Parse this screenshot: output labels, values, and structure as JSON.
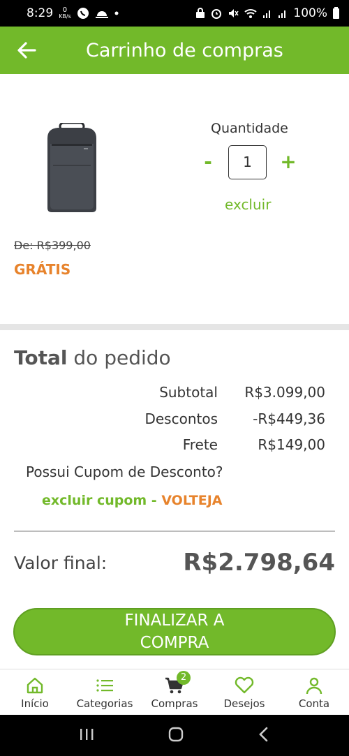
{
  "status_bar": {
    "time": "8:29",
    "net_speed_value": "0",
    "net_speed_unit": "KB/s",
    "battery": "100%"
  },
  "app_bar": {
    "title": "Carrinho de compras"
  },
  "product": {
    "quantity_label": "Quantidade",
    "quantity": "1",
    "minus": "-",
    "plus": "+",
    "remove_label": "excluir",
    "old_price": "De: R$399,00",
    "price": "GRÁTIS"
  },
  "summary": {
    "title_bold": "Total",
    "title_rest": " do pedido",
    "rows": [
      {
        "label": "Subtotal",
        "value": "R$3.099,00"
      },
      {
        "label": "Descontos",
        "value": "-R$449,36"
      },
      {
        "label": "Frete",
        "value": "R$149,00"
      }
    ],
    "coupon_question": "Possui Cupom de Desconto?",
    "coupon_remove": "excluir cupom -",
    "coupon_code": "VOLTEJA",
    "final_label": "Valor final:",
    "final_value": "R$2.798,64"
  },
  "checkout": {
    "label": "FINALIZAR A COMPRA"
  },
  "bottom_nav": {
    "items": [
      {
        "label": "Início",
        "icon": "home-icon"
      },
      {
        "label": "Categorias",
        "icon": "list-icon"
      },
      {
        "label": "Compras",
        "icon": "cart-icon",
        "badge": "2"
      },
      {
        "label": "Desejos",
        "icon": "heart-icon"
      },
      {
        "label": "Conta",
        "icon": "person-icon"
      }
    ]
  },
  "colors": {
    "brand_green": "#72b92a",
    "accent_orange": "#e7832c"
  }
}
